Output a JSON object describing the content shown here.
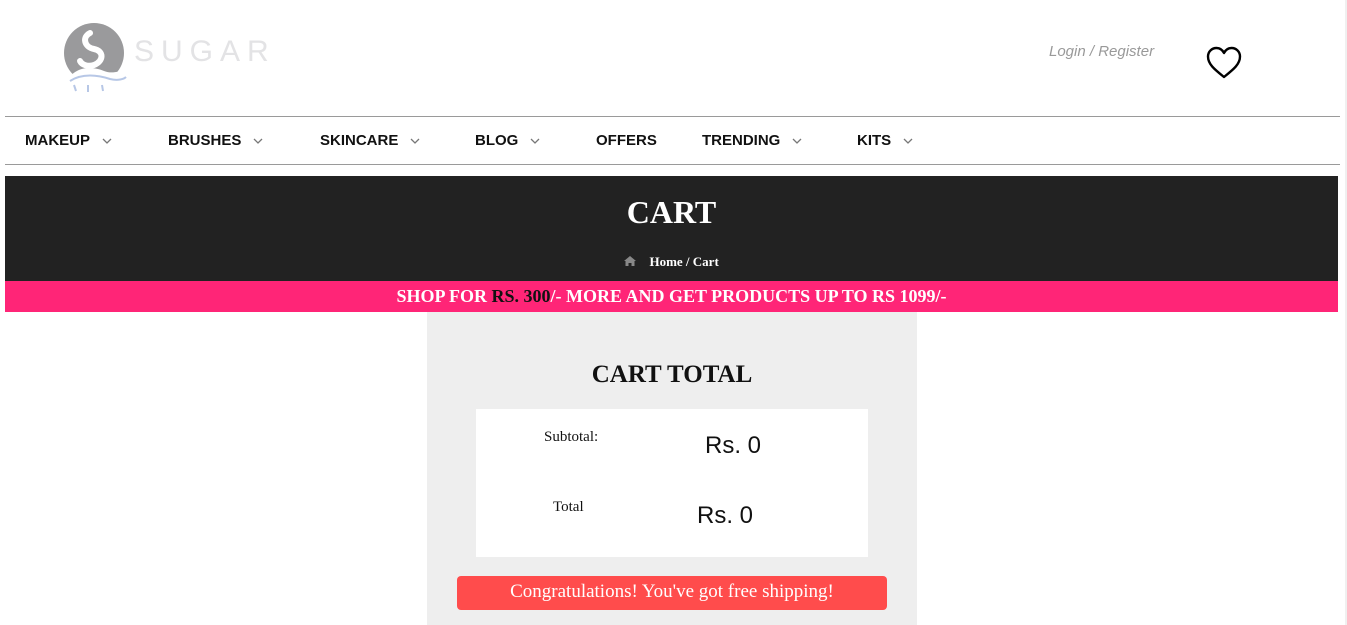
{
  "header": {
    "logo_text": "SUGAR",
    "login_register": "Login / Register",
    "wishlist_icon": "heart-outline-icon"
  },
  "nav": {
    "items": [
      {
        "label": "MAKEUP",
        "has_dropdown": true
      },
      {
        "label": "BRUSHES",
        "has_dropdown": true
      },
      {
        "label": "SKINCARE",
        "has_dropdown": true
      },
      {
        "label": "BLOG",
        "has_dropdown": true
      },
      {
        "label": "OFFERS",
        "has_dropdown": false
      },
      {
        "label": "TRENDING",
        "has_dropdown": true
      },
      {
        "label": "KITS",
        "has_dropdown": true
      }
    ]
  },
  "banner": {
    "title": "CART",
    "breadcrumb_home": "Home",
    "breadcrumb_sep": " / ",
    "breadcrumb_current": "Cart"
  },
  "promo": {
    "prefix": "SHOP FOR ",
    "amount": "RS. 300",
    "suffix": "/- MORE AND GET PRODUCTS UP TO RS 1099/-"
  },
  "cart_total": {
    "title": "CART TOTAL",
    "subtotal_label": "Subtotal:",
    "subtotal_value": "Rs. 0",
    "total_label": "Total",
    "total_value": "Rs. 0",
    "shipping_message": "Congratulations! You've got free shipping!"
  },
  "colors": {
    "banner_bg": "#222222",
    "promo_bg": "#ff2577",
    "panel_bg": "#eeeeee",
    "shipping_bg": "#ff4c4c"
  }
}
